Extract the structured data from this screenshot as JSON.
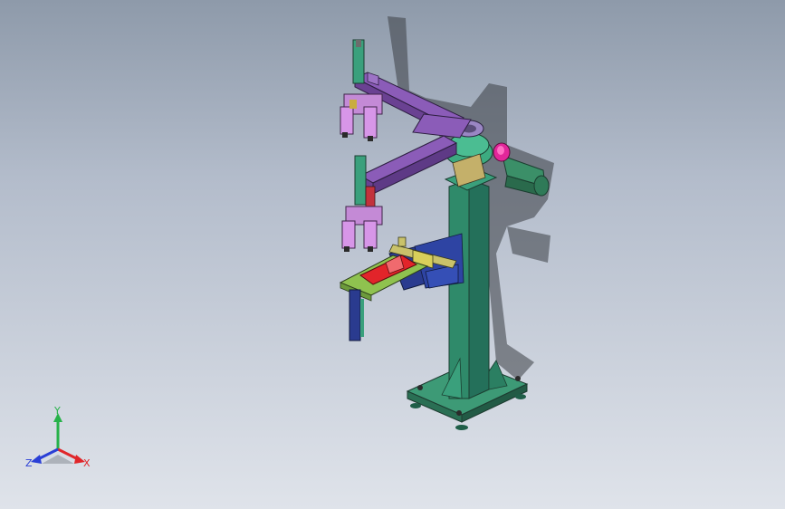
{
  "triad": {
    "x_label": "X",
    "y_label": "Y",
    "z_label": "Z"
  },
  "colors": {
    "background_top": "#8e9aaa",
    "background_bottom": "#dfe3ea",
    "column": "#2f8f6c",
    "arm": "#7a4ca3",
    "gripper": "#d08ae0",
    "slide": "#2a3b8f",
    "part_red": "#e2242a",
    "motor": "#3b8f68",
    "axis_x": "#e0262a",
    "axis_y": "#27b24a",
    "axis_z": "#2a3fd6"
  }
}
